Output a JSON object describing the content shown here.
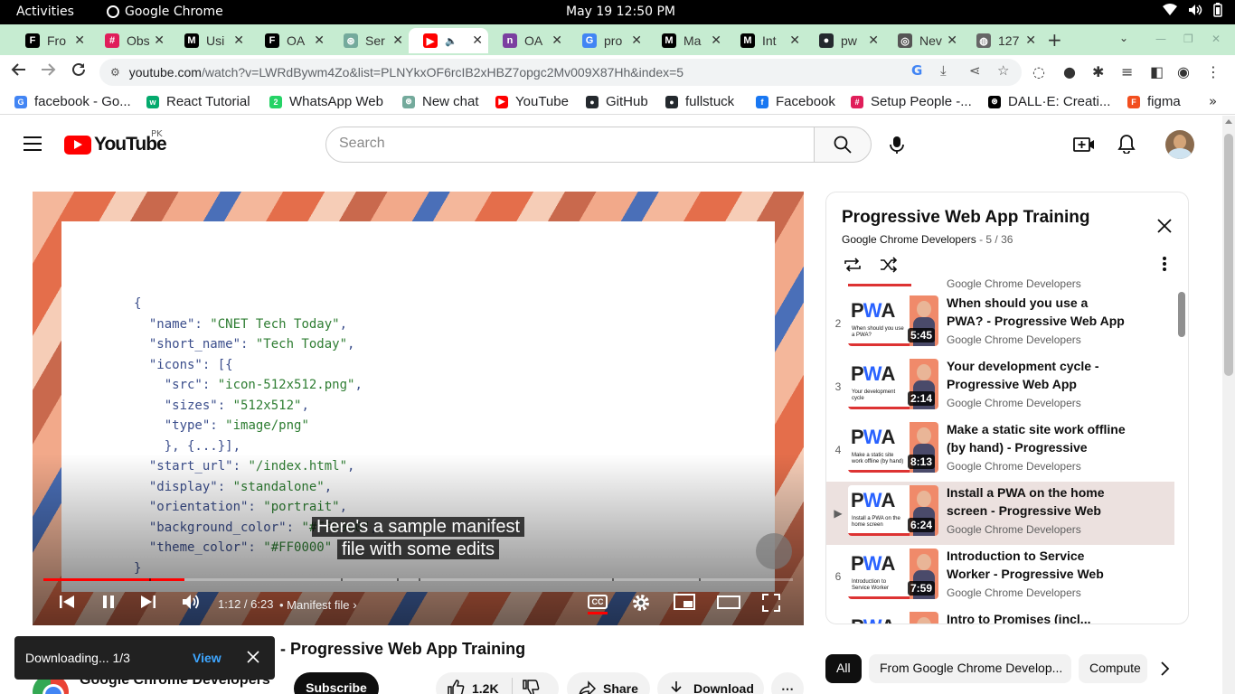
{
  "system": {
    "activities": "Activities",
    "app_name": "Google Chrome",
    "clock": "May 19  12:50 PM"
  },
  "tabs": [
    {
      "title": "Fro",
      "icon": "forbes-icon",
      "color": "#000000",
      "letter": "F"
    },
    {
      "title": "Obs",
      "icon": "slack-icon",
      "color": "#e01e5a",
      "letter": "#"
    },
    {
      "title": "Usi",
      "icon": "medium-icon",
      "color": "#000000",
      "letter": "M"
    },
    {
      "title": "OA",
      "icon": "forbes-icon",
      "color": "#000000",
      "letter": "F"
    },
    {
      "title": "Ser",
      "icon": "chatgpt-icon",
      "color": "#74aa9c",
      "letter": "⊛"
    },
    {
      "title": "",
      "icon": "youtube-icon",
      "color": "#ff0000",
      "letter": "▶",
      "active": true,
      "audio": "speaker-icon"
    },
    {
      "title": "OA",
      "icon": "app-icon",
      "color": "#7b3fa0",
      "letter": "n"
    },
    {
      "title": "pro",
      "icon": "google-icon",
      "color": "#4285f4",
      "letter": "G"
    },
    {
      "title": "Ma",
      "icon": "medium-icon",
      "color": "#000000",
      "letter": "M"
    },
    {
      "title": "Int",
      "icon": "medium-icon",
      "color": "#000000",
      "letter": "M"
    },
    {
      "title": "pw",
      "icon": "github-icon",
      "color": "#24292e",
      "letter": "●"
    },
    {
      "title": "Nev",
      "icon": "chrome-icon",
      "color": "#555555",
      "letter": "◎"
    },
    {
      "title": "127",
      "icon": "globe-icon",
      "color": "#666666",
      "letter": "◍"
    }
  ],
  "url": {
    "host": "youtube.com",
    "path": "/watch?v=LWRdBywm4Zo&list=PLNYkxOF6rcIB2xHBZ7opgc2Mv009X87Hh&index=5"
  },
  "bookmarks": [
    {
      "label": "facebook - Go...",
      "icon": "google-icon",
      "color": "#4285f4",
      "letter": "G"
    },
    {
      "label": "React Tutorial",
      "icon": "w3schools-icon",
      "color": "#04aa6d",
      "letter": "w"
    },
    {
      "label": "WhatsApp Web",
      "icon": "whatsapp-icon",
      "color": "#25d366",
      "letter": "2"
    },
    {
      "label": "New chat",
      "icon": "chatgpt-icon",
      "color": "#74aa9c",
      "letter": "⊛"
    },
    {
      "label": "YouTube",
      "icon": "youtube-icon",
      "color": "#ff0000",
      "letter": "▶"
    },
    {
      "label": "GitHub",
      "icon": "github-icon",
      "color": "#24292e",
      "letter": "●"
    },
    {
      "label": "fullstuck",
      "icon": "github-icon",
      "color": "#24292e",
      "letter": "●"
    },
    {
      "label": "Facebook",
      "icon": "facebook-icon",
      "color": "#1877f2",
      "letter": "f"
    },
    {
      "label": "Setup People -...",
      "icon": "slack-icon",
      "color": "#e01e5a",
      "letter": "#"
    },
    {
      "label": "DALL·E: Creati...",
      "icon": "openai-icon",
      "color": "#000000",
      "letter": "⊛"
    },
    {
      "label": "figma",
      "icon": "figma-icon",
      "color": "#f24e1e",
      "letter": "F"
    }
  ],
  "youtube": {
    "logo_word": "YouTube",
    "country": "PK",
    "search_placeholder": "Search"
  },
  "video": {
    "code_lines": [
      "{",
      "  \"name\": \"CNET Tech Today\",",
      "  \"short_name\": \"Tech Today\",",
      "  \"icons\": [{",
      "    \"src\": \"icon-512x512.png\",",
      "    \"sizes\": \"512x512\",",
      "    \"type\": \"image/png\"",
      "    }, {...}],",
      "  \"start_url\": \"/index.html\",",
      "  \"display\": \"standalone\",",
      "  \"orientation\": \"portrait\",",
      "  \"background_color\": \"#FF0000\",",
      "  \"theme_color\": \"#FF0000\"",
      "}"
    ],
    "caption_line1": "Here's a sample manifest",
    "caption_line2": "file with some edits",
    "time": "1:12 / 6:23",
    "chapter": "• Manifest file",
    "progress": 0.188,
    "title_visible": "en - Progressive Web App Training"
  },
  "playlist": {
    "title": "Progressive Web App Training",
    "channel": "Google Chrome Developers",
    "position": "- 5 / 36",
    "top_partial_channel": "Google Chrome Developers",
    "items": [
      {
        "num": "2",
        "title": "When should you use a PWA? - Progressive Web App Training",
        "channel": "Google Chrome Developers",
        "duration": "5:45",
        "thumb_text": "When should you use a PWA?"
      },
      {
        "num": "3",
        "title": "Your development cycle - Progressive Web App Training",
        "channel": "Google Chrome Developers",
        "duration": "2:14",
        "thumb_text": "Your development cycle"
      },
      {
        "num": "4",
        "title": "Make a static site work offline (by hand) - Progressive Web...",
        "channel": "Google Chrome Developers",
        "duration": "8:13",
        "thumb_text": "Make a static site work offline (by hand)"
      },
      {
        "num": "▶",
        "title": "Install a PWA on the home screen - Progressive Web Ap...",
        "channel": "Google Chrome Developers",
        "duration": "6:24",
        "thumb_text": "Install a PWA on the home screen",
        "active": true
      },
      {
        "num": "6",
        "title": "Introduction to Service Worker - Progressive Web App Training",
        "channel": "Google Chrome Developers",
        "duration": "7:59",
        "thumb_text": "Introduction to Service Worker"
      },
      {
        "num": "",
        "title": "Intro to Promises (incl...",
        "channel": "",
        "duration": "",
        "thumb_text": ""
      }
    ]
  },
  "below": {
    "channel_name": "Google Chrome Developers",
    "subscribe": "Subscribe",
    "likes": "1.2K",
    "share": "Share",
    "download": "Download"
  },
  "toast": {
    "message": "Downloading... 1/3",
    "action": "View"
  },
  "chips": [
    "All",
    "From Google Chrome Develop...",
    "Compute"
  ]
}
